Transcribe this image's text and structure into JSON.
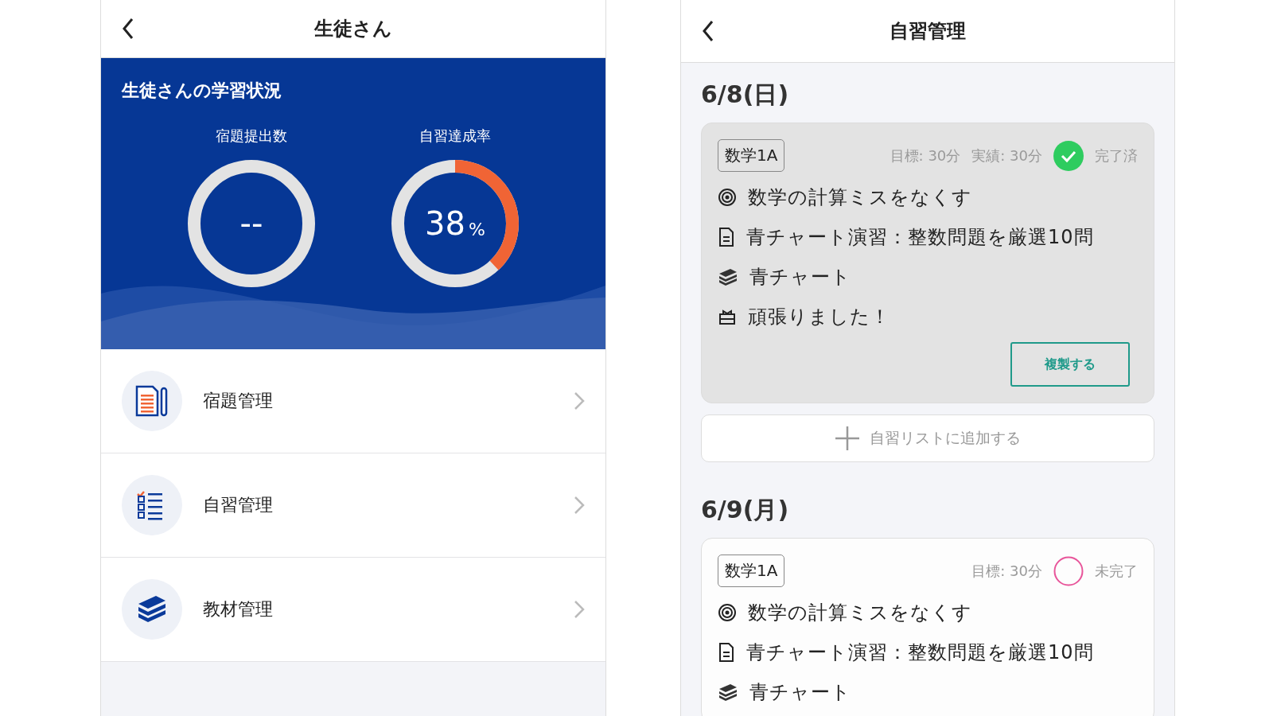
{
  "left_screen": {
    "title": "生徒さん",
    "status_panel": {
      "title": "生徒さんの学習状況",
      "stats": [
        {
          "label": "宿題提出数",
          "value": "--"
        },
        {
          "label": "自習達成率",
          "value": "38",
          "unit": "%",
          "level": 0.38
        }
      ]
    },
    "menu": [
      {
        "kind": "homework",
        "label": "宿題管理"
      },
      {
        "kind": "self_study",
        "label": "自習管理"
      },
      {
        "kind": "materials",
        "label": "教材管理"
      }
    ]
  },
  "right_screen": {
    "title": "自習管理",
    "days": [
      {
        "date": "6/8(日)",
        "entries": [
          {
            "subject": "数学1A",
            "metrics": [
              "目標: 30分",
              "実績: 30分"
            ],
            "completed": true,
            "status": "完了済",
            "lines": [
              {
                "kind": "goal",
                "text": "数学の計算ミスをなくす"
              },
              {
                "kind": "task",
                "text": "青チャート演習：整数問題を厳選10問"
              },
              {
                "kind": "material",
                "text": "青チャート"
              },
              {
                "kind": "comment",
                "text": "頑張りました！"
              }
            ],
            "action": "複製する"
          }
        ],
        "add_button": "自習リストに追加する"
      },
      {
        "date": "6/9(月)",
        "entries": [
          {
            "subject": "数学1A",
            "metrics": [
              "目標: 30分"
            ],
            "completed": false,
            "status": "未完了",
            "lines": [
              {
                "kind": "goal",
                "text": "数学の計算ミスをなくす"
              },
              {
                "kind": "task",
                "text": "青チャート演習：整数問題を厳選10問"
              },
              {
                "kind": "material",
                "text": "青チャート"
              }
            ]
          }
        ]
      }
    ]
  }
}
